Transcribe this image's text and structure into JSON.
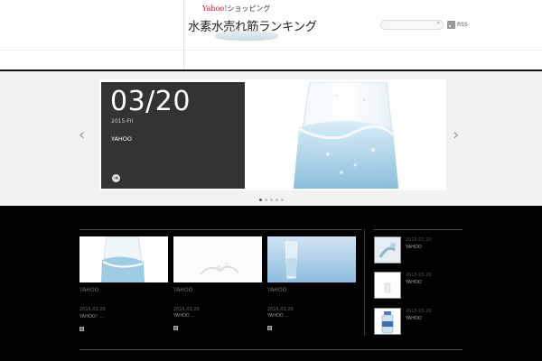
{
  "site": {
    "logo_top_brand": "Yahoo!",
    "logo_top_rest": "ショッピング",
    "logo_main": "水素水売れ筋ランキング",
    "rss_label": "RSS",
    "search_arrow": "»"
  },
  "slider": {
    "date": "03/20",
    "day": "2015-Fri",
    "title": "YAHOO",
    "more_glyph": "➜",
    "prev_glyph": "‹",
    "next_glyph": "›",
    "dot_count": 5,
    "active_dot": 0
  },
  "cards": [
    {
      "title": "YAHOO",
      "date": "2015.03.20",
      "text": "YAHOO！...",
      "image": "water-bottle"
    },
    {
      "title": "YAHOO",
      "date": "2015.03.20",
      "text": "YAHOO ...",
      "image": "water-splash"
    },
    {
      "title": "YAHOO",
      "date": "2015.03.20",
      "text": "YAHOO ...",
      "image": "water-glass"
    }
  ],
  "sidebar": [
    {
      "date": "2015.03.20",
      "title": "YAHOO",
      "image": "water-pour"
    },
    {
      "date": "2015.03.20",
      "title": "YAHOO",
      "image": "water-glass-small"
    },
    {
      "date": "2015.03.20",
      "title": "YAHOO",
      "image": "water-bottle-blue"
    }
  ]
}
